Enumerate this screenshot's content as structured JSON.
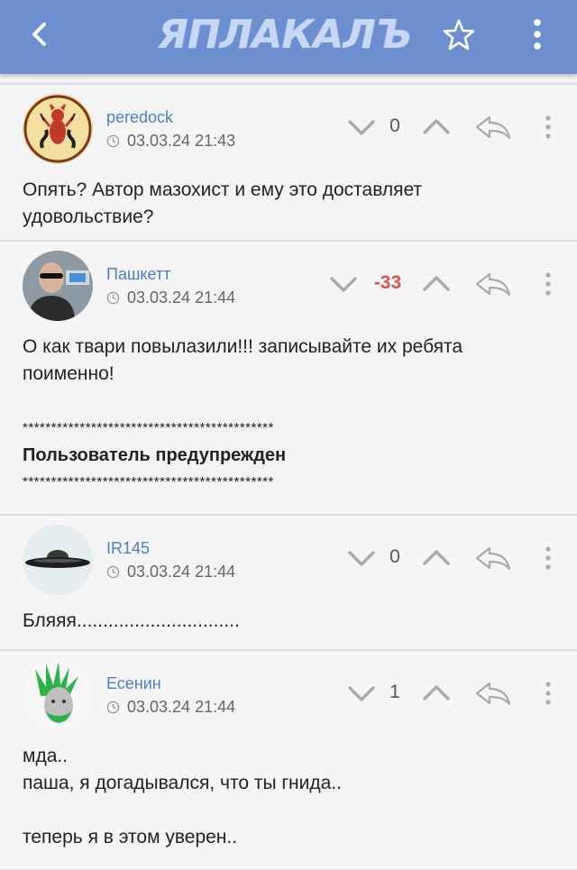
{
  "app": {
    "logo_text": "ЯПЛАКАЛЪ",
    "accent_color": "#6d8fd0",
    "username_color": "#4f7dc7",
    "negative_color": "#d9534f",
    "icons": [
      "back-arrow-icon",
      "star-icon",
      "more-vertical-icon"
    ]
  },
  "comments": [
    {
      "username": "peredock",
      "time": "03.03.24 21:43",
      "score": "0",
      "text": "Опять? Автор мазохист и ему это доставляет удовольствие?"
    },
    {
      "username": "Пашкетт",
      "time": "03.03.24 21:44",
      "score": "-33",
      "text": "О как твари повылазили!!! записывайте их ребята поименно!",
      "stars_top": "********************************************",
      "warning": "Пользователь предупрежден",
      "stars_bottom": "********************************************"
    },
    {
      "username": "IR145",
      "time": "03.03.24 21:44",
      "score": "0",
      "text": "Бляяя..............................."
    },
    {
      "username": "Есенин",
      "time": "03.03.24 21:44",
      "score": "1",
      "lines": [
        "мда..",
        "паша, я догадывался, что ты гнида..",
        "",
        "теперь я в этом уверен.."
      ]
    }
  ]
}
